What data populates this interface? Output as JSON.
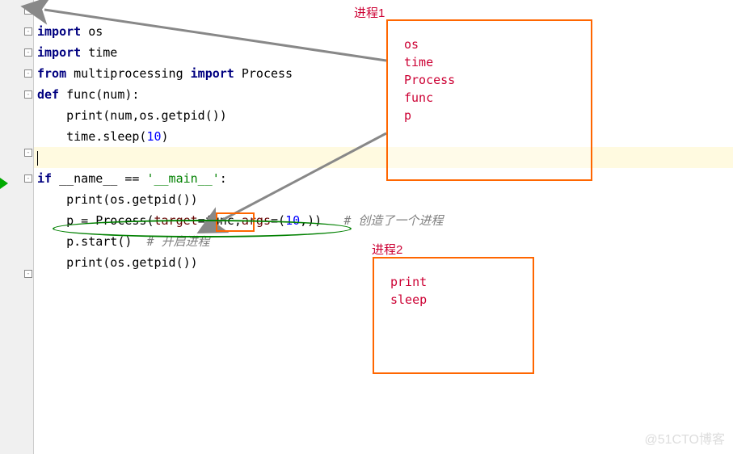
{
  "code": {
    "l1a": "import",
    "l1b": " os",
    "l2a": "import",
    "l2b": " time",
    "l3a": "from",
    "l3b": " multiprocessing ",
    "l3c": "import",
    "l3d": " Process",
    "l4a": "def ",
    "l4b": "func(num):",
    "l5a": "    print(num,os.getpid())",
    "l6a": "    time.sleep(",
    "l6b": "10",
    "l6c": ")",
    "l7a": "",
    "l8a": "if",
    "l8b": " __name__ == ",
    "l8c": "'__main__'",
    "l8d": ":",
    "l9a": "    print(os.getpid())",
    "l10a": "    p = Process(",
    "l10b": "target",
    "l10c": "=func,",
    "l10d": "args",
    "l10e": "=(",
    "l10f": "10",
    "l10g": ",))   ",
    "l10h": "# 创造了一个进程",
    "l11a": "    p.start()  ",
    "l11b": "# 开启进程",
    "l12a": "    print(os.getpid())"
  },
  "annotations": {
    "label1": "进程1",
    "box1_content": "os\ntime\nProcess\nfunc\np",
    "label2": "进程2",
    "box2_content": "print\nsleep"
  },
  "watermark": "@51CTO博客"
}
